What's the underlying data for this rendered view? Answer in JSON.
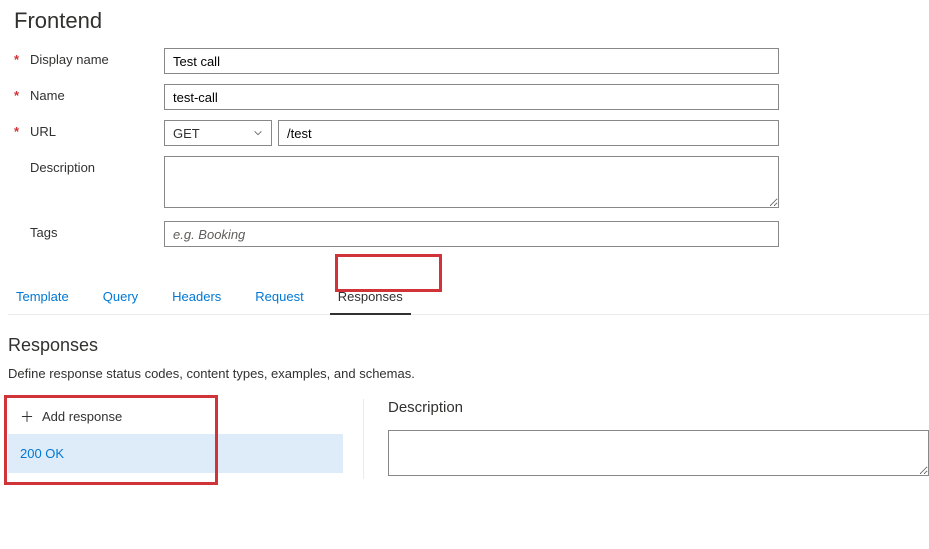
{
  "page_title": "Frontend",
  "form": {
    "display_name": {
      "label": "Display name",
      "value": "Test call",
      "required": true
    },
    "name": {
      "label": "Name",
      "value": "test-call",
      "required": true
    },
    "url": {
      "label": "URL",
      "method": "GET",
      "path": "/test",
      "required": true
    },
    "description": {
      "label": "Description",
      "value": ""
    },
    "tags": {
      "label": "Tags",
      "value": "",
      "placeholder": "e.g. Booking"
    }
  },
  "tabs": {
    "items": [
      {
        "label": "Template",
        "active": false
      },
      {
        "label": "Query",
        "active": false
      },
      {
        "label": "Headers",
        "active": false
      },
      {
        "label": "Request",
        "active": false
      },
      {
        "label": "Responses",
        "active": true
      }
    ]
  },
  "responses": {
    "title": "Responses",
    "helper": "Define response status codes, content types, examples, and schemas.",
    "add_label": "Add response",
    "items": [
      {
        "label": "200 OK",
        "selected": true
      }
    ],
    "detail": {
      "description_label": "Description",
      "description_value": ""
    }
  }
}
